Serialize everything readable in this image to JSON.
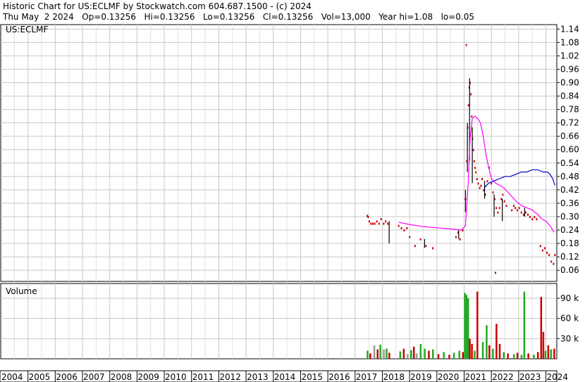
{
  "header": {
    "title": "Historic Chart for US:ECLMF by Stockwatch.com 604.687.1500 - (c) 2024",
    "date": "Thu May  2 2024",
    "open": "Op=0.13256",
    "high": "Hi=0.13256",
    "low": "Lo=0.13256",
    "close": "Cl=0.13256",
    "volume": "Vol=13,000",
    "year_high": "Year hi=1.08",
    "year_low": "lo=0.05"
  },
  "chart_data": [
    {
      "type": "bar",
      "subtype": "ohlc-price",
      "symbol_label": "US:ECLMF",
      "price_axis": {
        "ticks": [
          0.06,
          0.12,
          0.18,
          0.24,
          0.3,
          0.36,
          0.42,
          0.48,
          0.54,
          0.6,
          0.66,
          0.72,
          0.78,
          0.84,
          0.9,
          0.96,
          1.02,
          1.08,
          1.14
        ],
        "ylim": [
          0.01,
          1.16
        ]
      },
      "x_axis": {
        "years": [
          "2004",
          "2005",
          "2006",
          "2007",
          "2008",
          "2009",
          "2010",
          "2011",
          "2012",
          "2013",
          "2014",
          "2015",
          "2016",
          "2017",
          "2018",
          "2019",
          "2020",
          "2021",
          "2022",
          "2023",
          "2024"
        ],
        "xlim": [
          2004.0,
          2024.4
        ]
      },
      "grid": true,
      "series": [
        {
          "role": "price-ticks",
          "color": "#cc0000",
          "points": [
            [
              2017.45,
              0.305
            ],
            [
              2017.48,
              0.3
            ],
            [
              2017.52,
              0.28
            ],
            [
              2017.58,
              0.27
            ],
            [
              2017.65,
              0.27
            ],
            [
              2017.72,
              0.27
            ],
            [
              2017.8,
              0.28
            ],
            [
              2017.88,
              0.27
            ],
            [
              2017.95,
              0.29
            ],
            [
              2018.05,
              0.27
            ],
            [
              2018.12,
              0.28
            ],
            [
              2018.2,
              0.27
            ],
            [
              2018.6,
              0.26
            ],
            [
              2018.7,
              0.25
            ],
            [
              2018.8,
              0.24
            ],
            [
              2018.9,
              0.25
            ],
            [
              2019.0,
              0.21
            ],
            [
              2019.2,
              0.17
            ],
            [
              2019.4,
              0.2
            ],
            [
              2019.6,
              0.17
            ],
            [
              2019.85,
              0.16
            ],
            [
              2020.7,
              0.21
            ],
            [
              2020.78,
              0.23
            ],
            [
              2020.85,
              0.2
            ],
            [
              2020.95,
              0.24
            ],
            [
              2021.05,
              0.38
            ],
            [
              2021.1,
              0.55
            ],
            [
              2021.13,
              0.7
            ],
            [
              2021.16,
              0.8
            ],
            [
              2021.19,
              0.88
            ],
            [
              2021.22,
              0.9
            ],
            [
              2021.25,
              0.85
            ],
            [
              2021.28,
              0.75
            ],
            [
              2021.31,
              0.65
            ],
            [
              2021.34,
              0.6
            ],
            [
              2021.37,
              0.55
            ],
            [
              2021.4,
              0.52
            ],
            [
              2021.43,
              0.5
            ],
            [
              2021.47,
              0.47
            ],
            [
              2021.52,
              0.45
            ],
            [
              2021.57,
              0.43
            ],
            [
              2021.62,
              0.44
            ],
            [
              2021.66,
              0.47
            ],
            [
              2021.72,
              0.42
            ],
            [
              2021.78,
              0.4
            ],
            [
              2021.85,
              0.46
            ],
            [
              2021.92,
              0.52
            ],
            [
              2022.0,
              0.45
            ],
            [
              2022.06,
              0.41
            ],
            [
              2022.12,
              0.38
            ],
            [
              2022.18,
              0.34
            ],
            [
              2022.24,
              0.32
            ],
            [
              2022.3,
              0.34
            ],
            [
              2022.36,
              0.38
            ],
            [
              2022.42,
              0.4
            ],
            [
              2022.48,
              0.37
            ],
            [
              2022.55,
              0.35
            ],
            [
              2021.08,
              1.07
            ],
            [
              2022.15,
              0.05
            ],
            [
              2022.75,
              0.33
            ],
            [
              2022.82,
              0.35
            ],
            [
              2022.88,
              0.34
            ],
            [
              2022.95,
              0.33
            ],
            [
              2023.02,
              0.34
            ],
            [
              2023.1,
              0.32
            ],
            [
              2023.18,
              0.31
            ],
            [
              2023.26,
              0.32
            ],
            [
              2023.34,
              0.31
            ],
            [
              2023.42,
              0.3
            ],
            [
              2023.5,
              0.29
            ],
            [
              2023.58,
              0.3
            ],
            [
              2023.66,
              0.29
            ],
            [
              2023.8,
              0.17
            ],
            [
              2023.88,
              0.15
            ],
            [
              2023.96,
              0.16
            ],
            [
              2024.04,
              0.14
            ],
            [
              2024.12,
              0.13
            ],
            [
              2024.2,
              0.1
            ],
            [
              2024.28,
              0.09
            ],
            [
              2024.33,
              0.13
            ]
          ]
        },
        {
          "role": "price-range-bars",
          "color": "#000000",
          "bars": [
            [
              2018.25,
              0.28,
              0.18
            ],
            [
              2019.55,
              0.2,
              0.16
            ],
            [
              2020.8,
              0.24,
              0.2
            ],
            [
              2021.05,
              0.42,
              0.32
            ],
            [
              2021.12,
              0.72,
              0.5
            ],
            [
              2021.2,
              0.92,
              0.55
            ],
            [
              2021.3,
              0.7,
              0.45
            ],
            [
              2021.75,
              0.46,
              0.38
            ],
            [
              2022.1,
              0.4,
              0.3
            ],
            [
              2022.4,
              0.38,
              0.28
            ],
            [
              2023.22,
              0.34,
              0.3
            ]
          ]
        },
        {
          "role": "moving-average-short",
          "color": "#ff00ff",
          "points": [
            [
              2018.6,
              0.275
            ],
            [
              2019.0,
              0.265
            ],
            [
              2019.5,
              0.255
            ],
            [
              2020.0,
              0.25
            ],
            [
              2020.5,
              0.245
            ],
            [
              2020.9,
              0.24
            ],
            [
              2021.05,
              0.26
            ],
            [
              2021.15,
              0.45
            ],
            [
              2021.22,
              0.65
            ],
            [
              2021.3,
              0.74
            ],
            [
              2021.4,
              0.75
            ],
            [
              2021.5,
              0.74
            ],
            [
              2021.6,
              0.72
            ],
            [
              2021.7,
              0.66
            ],
            [
              2021.8,
              0.58
            ],
            [
              2021.9,
              0.52
            ],
            [
              2022.0,
              0.47
            ],
            [
              2022.15,
              0.45
            ],
            [
              2022.3,
              0.44
            ],
            [
              2022.45,
              0.43
            ],
            [
              2022.6,
              0.41
            ],
            [
              2022.75,
              0.39
            ],
            [
              2022.9,
              0.37
            ],
            [
              2023.1,
              0.35
            ],
            [
              2023.3,
              0.34
            ],
            [
              2023.5,
              0.33
            ],
            [
              2023.7,
              0.31
            ],
            [
              2023.85,
              0.29
            ],
            [
              2024.0,
              0.28
            ],
            [
              2024.15,
              0.26
            ],
            [
              2024.3,
              0.23
            ]
          ]
        },
        {
          "role": "moving-average-long",
          "color": "#0000cc",
          "points": [
            [
              2021.75,
              0.43
            ],
            [
              2021.9,
              0.45
            ],
            [
              2022.1,
              0.46
            ],
            [
              2022.3,
              0.47
            ],
            [
              2022.5,
              0.48
            ],
            [
              2022.7,
              0.48
            ],
            [
              2022.9,
              0.49
            ],
            [
              2023.1,
              0.5
            ],
            [
              2023.3,
              0.5
            ],
            [
              2023.5,
              0.51
            ],
            [
              2023.7,
              0.51
            ],
            [
              2023.9,
              0.5
            ],
            [
              2024.05,
              0.5
            ],
            [
              2024.15,
              0.49
            ],
            [
              2024.25,
              0.47
            ],
            [
              2024.33,
              0.44
            ]
          ]
        }
      ]
    },
    {
      "type": "bar",
      "subtype": "volume",
      "title": "Volume",
      "volume_axis": {
        "ticks": [
          30000,
          60000,
          90000
        ],
        "tick_labels": [
          "30 k",
          "60 k",
          "90 k"
        ],
        "ylim": [
          0,
          112000
        ]
      },
      "up_color": "#22aa22",
      "down_color": "#cc0000",
      "neutral_color": "#999999",
      "bars": [
        [
          2017.45,
          12000,
          "up"
        ],
        [
          2017.55,
          8000,
          "down"
        ],
        [
          2017.7,
          20000,
          "neutral"
        ],
        [
          2017.82,
          14000,
          "down"
        ],
        [
          2017.92,
          21000,
          "up"
        ],
        [
          2018.05,
          14000,
          "neutral"
        ],
        [
          2018.15,
          15000,
          "up"
        ],
        [
          2018.25,
          9000,
          "down"
        ],
        [
          2018.65,
          11000,
          "up"
        ],
        [
          2018.78,
          15000,
          "down"
        ],
        [
          2018.92,
          7000,
          "neutral"
        ],
        [
          2019.05,
          13000,
          "up"
        ],
        [
          2019.15,
          18000,
          "down"
        ],
        [
          2019.25,
          8000,
          "neutral"
        ],
        [
          2019.4,
          22000,
          "up"
        ],
        [
          2019.55,
          15000,
          "up"
        ],
        [
          2019.7,
          12000,
          "down"
        ],
        [
          2019.85,
          14000,
          "up"
        ],
        [
          2020.05,
          7000,
          "down"
        ],
        [
          2020.25,
          10000,
          "up"
        ],
        [
          2020.45,
          6000,
          "down"
        ],
        [
          2020.62,
          9000,
          "up"
        ],
        [
          2020.82,
          12000,
          "up"
        ],
        [
          2020.95,
          10000,
          "down"
        ],
        [
          2021.02,
          98000,
          "up"
        ],
        [
          2021.08,
          95000,
          "up"
        ],
        [
          2021.14,
          90000,
          "up"
        ],
        [
          2021.2,
          30000,
          "down"
        ],
        [
          2021.28,
          22000,
          "down"
        ],
        [
          2021.38,
          12000,
          "up"
        ],
        [
          2021.48,
          100000,
          "down"
        ],
        [
          2021.68,
          25000,
          "up"
        ],
        [
          2021.82,
          50000,
          "up"
        ],
        [
          2021.92,
          20000,
          "down"
        ],
        [
          2022.05,
          15000,
          "up"
        ],
        [
          2022.18,
          52000,
          "down"
        ],
        [
          2022.3,
          22000,
          "down"
        ],
        [
          2022.45,
          10000,
          "up"
        ],
        [
          2022.6,
          8000,
          "down"
        ],
        [
          2022.82,
          7000,
          "up"
        ],
        [
          2022.95,
          9000,
          "down"
        ],
        [
          2023.1,
          6000,
          "up"
        ],
        [
          2023.2,
          100000,
          "up"
        ],
        [
          2023.35,
          8000,
          "down"
        ],
        [
          2023.55,
          6000,
          "up"
        ],
        [
          2023.7,
          10000,
          "down"
        ],
        [
          2023.82,
          92000,
          "down"
        ],
        [
          2023.9,
          40000,
          "down"
        ],
        [
          2023.98,
          12000,
          "up"
        ],
        [
          2024.08,
          20000,
          "down"
        ],
        [
          2024.18,
          14000,
          "up"
        ],
        [
          2024.3,
          15000,
          "down"
        ]
      ]
    }
  ]
}
